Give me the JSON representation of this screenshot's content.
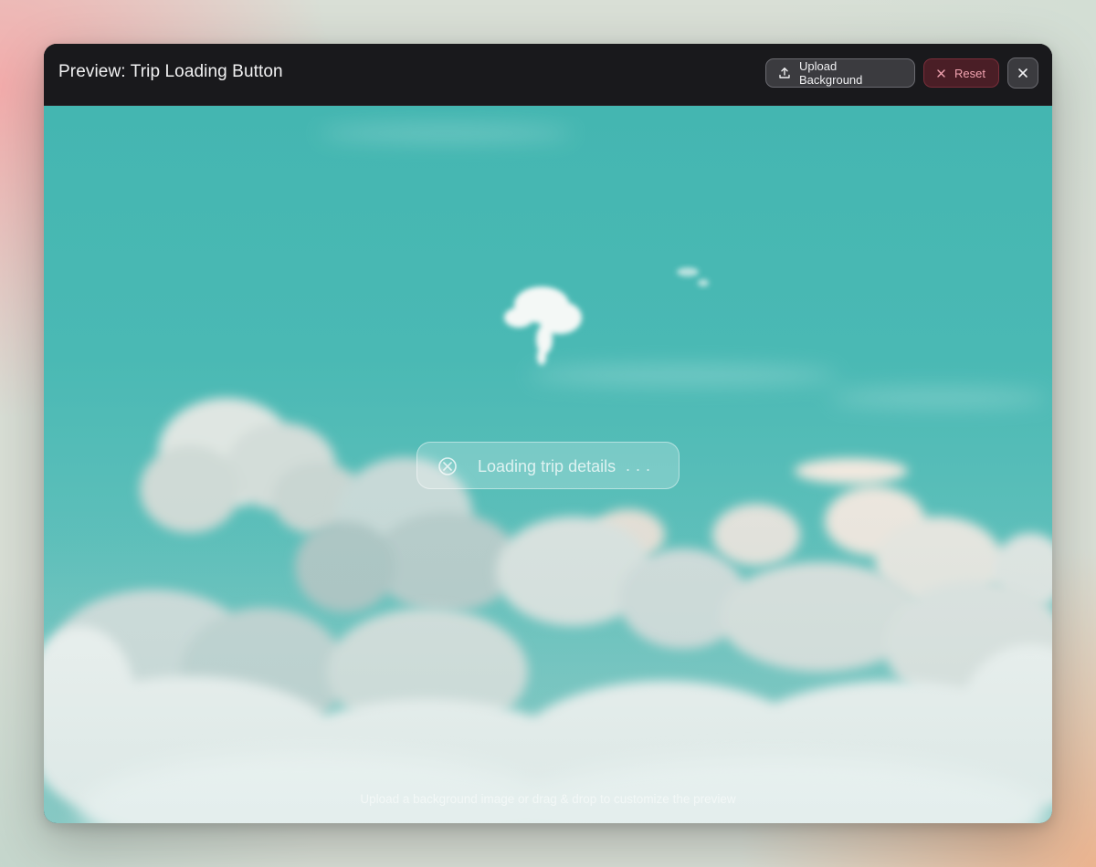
{
  "window": {
    "title": "Preview: Trip Loading Button"
  },
  "toolbar": {
    "upload_label": "Upload Background",
    "upload_icon": "upload-icon",
    "reset_label": "Reset",
    "reset_icon": "x-icon",
    "close_icon": "close-icon"
  },
  "preview": {
    "background": "clouds-sky-image",
    "loading_button": {
      "label": "Loading trip details",
      "dots": "...",
      "icon": "cancel-circle-icon"
    },
    "hint": "Upload a background image or drag & drop to customize the preview"
  },
  "colors": {
    "titlebar": "#19191c",
    "reset_accent": "#f1a3b0",
    "sky": "#44b6b1"
  }
}
